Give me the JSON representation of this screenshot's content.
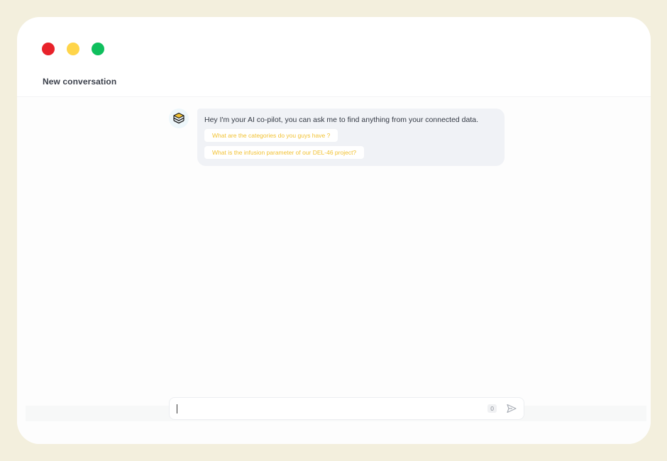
{
  "window": {
    "title": "New conversation",
    "traffic_lights": [
      "#e8222a",
      "#ffd54a",
      "#0fbf5d"
    ]
  },
  "assistant": {
    "avatar_icon": "stack-cube-icon",
    "greeting": "Hey I'm your AI co-pilot, you can ask me to find anything from your connected data.",
    "suggestions": [
      "What are the categories do you guys have ?",
      "What is the infusion parameter of our DEL-46 project?"
    ]
  },
  "composer": {
    "value": "",
    "placeholder": "",
    "char_count": "0",
    "send_icon": "send-icon"
  },
  "colors": {
    "background": "#f3efdd",
    "bubble": "#f0f2f6",
    "accent": "#f2c233"
  }
}
